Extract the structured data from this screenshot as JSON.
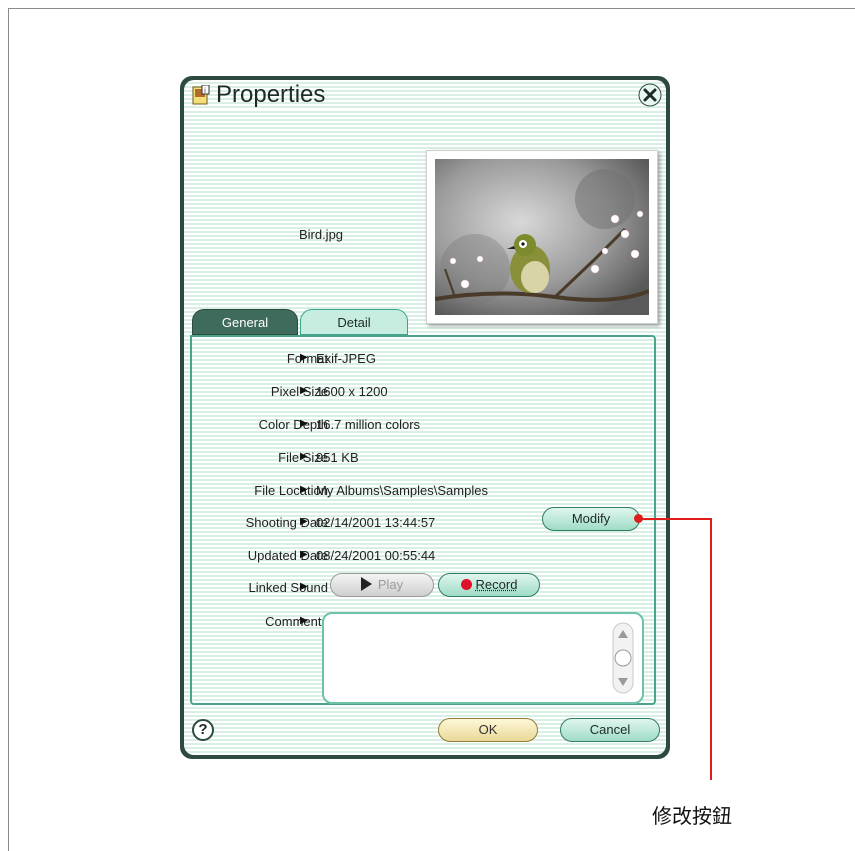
{
  "window": {
    "title": "Properties"
  },
  "file": {
    "name": "Bird.jpg"
  },
  "tabs": [
    {
      "label": "General"
    },
    {
      "label": "Detail"
    }
  ],
  "general": {
    "rows": [
      {
        "label": "Format",
        "value": "Exif-JPEG"
      },
      {
        "label": "Pixel Size",
        "value": "1600 x 1200"
      },
      {
        "label": "Color Depth",
        "value": "16.7 million colors"
      },
      {
        "label": "File Size",
        "value": "951 KB"
      },
      {
        "label": "File Location",
        "value": "My Albums\\Samples\\Samples"
      },
      {
        "label": "Shooting Date",
        "value": "02/14/2001 13:44:57"
      },
      {
        "label": "Updated Date",
        "value": "08/24/2001 00:55:44"
      }
    ],
    "linked_sound_label": "Linked Sound",
    "comments_label": "Comments",
    "comments_value": ""
  },
  "buttons": {
    "modify": "Modify",
    "play": "Play",
    "record": "Record",
    "ok": "OK",
    "cancel": "Cancel",
    "help": "?"
  },
  "annotation": {
    "label": "修改按鈕"
  },
  "colors": {
    "accent": "#4aa58c",
    "record_dot": "#e0102a",
    "callout": "#e01d1d",
    "titlebar_dark": "#2e4a40"
  }
}
